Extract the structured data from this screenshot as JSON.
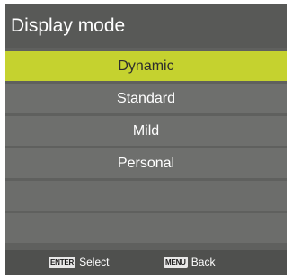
{
  "menu": {
    "title": "Display mode",
    "items": [
      {
        "label": "Dynamic",
        "selected": true
      },
      {
        "label": "Standard",
        "selected": false
      },
      {
        "label": "Mild",
        "selected": false
      },
      {
        "label": "Personal",
        "selected": false
      },
      {
        "label": "",
        "selected": false
      },
      {
        "label": "",
        "selected": false
      }
    ]
  },
  "footer": {
    "select_key": "ENTER",
    "select_label": "Select",
    "back_key": "MENU",
    "back_label": "Back"
  },
  "colors": {
    "highlight": "#c5d22f",
    "panel": "#5f605e",
    "item": "#6e6f6d"
  }
}
